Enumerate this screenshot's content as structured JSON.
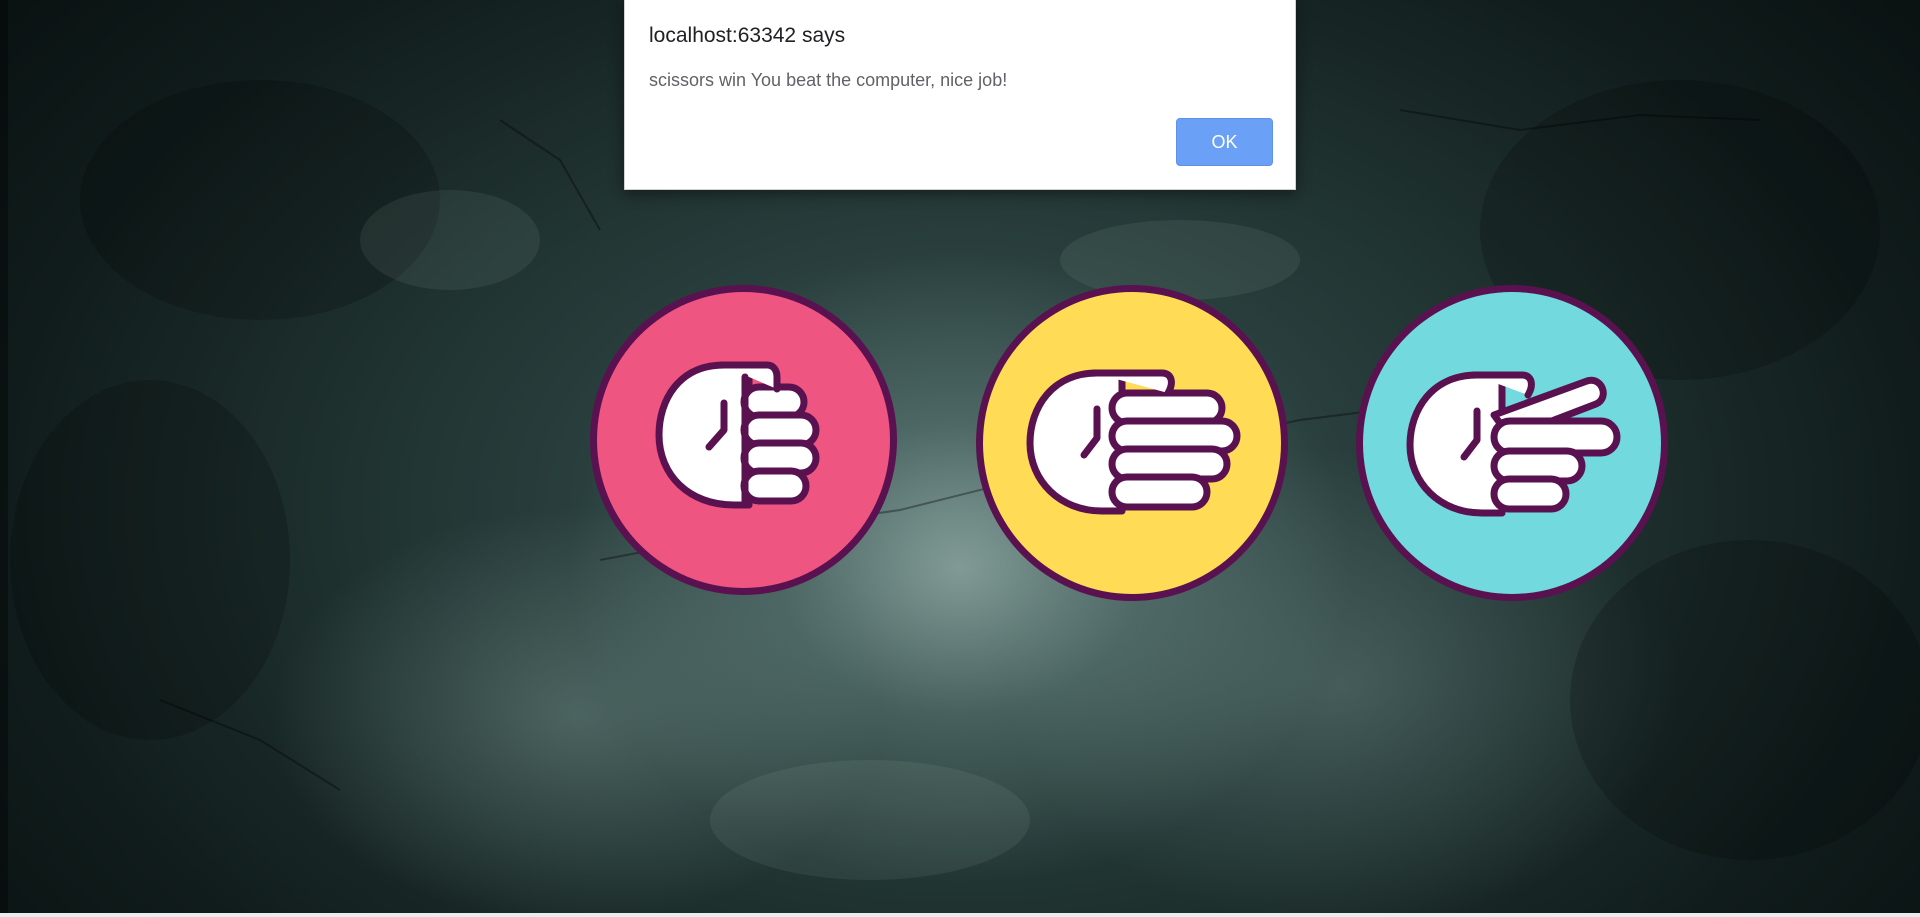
{
  "dialog": {
    "title": "localhost:63342 says",
    "message": "scissors win You beat the computer, nice job!",
    "ok_label": "OK"
  },
  "choices": [
    {
      "name": "rock",
      "color": "#ee5580"
    },
    {
      "name": "paper",
      "color": "#ffdb56"
    },
    {
      "name": "scissors",
      "color": "#72d9df"
    }
  ],
  "colors": {
    "outline": "#5a1150",
    "hand_fill": "#ffffff",
    "button_accent": "#6aa0f5"
  }
}
